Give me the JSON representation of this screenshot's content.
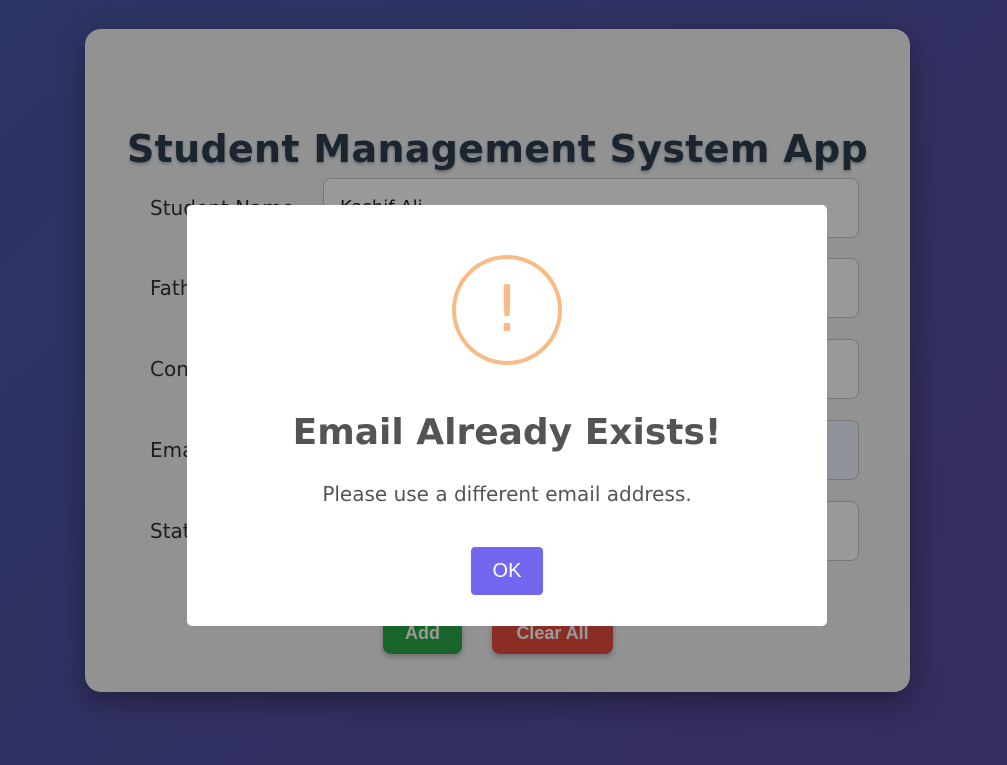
{
  "app": {
    "title": "Student Management System App"
  },
  "form": {
    "student_name": {
      "label": "Student Name",
      "value": "Kashif Ali"
    },
    "father_name": {
      "label": "Father Name",
      "value": ""
    },
    "contact": {
      "label": "Contact",
      "value": ""
    },
    "email": {
      "label": "Email",
      "value": ""
    },
    "status": {
      "label": "Status",
      "value": ""
    }
  },
  "actions": {
    "add_label": "Add",
    "clear_label": "Clear All"
  },
  "alert": {
    "icon_symbol": "!",
    "icon": "warning-icon",
    "title": "Email Already Exists!",
    "message": "Please use a different email address.",
    "ok_label": "OK"
  },
  "colors": {
    "add": "#28a745",
    "clear": "#e74c3c",
    "ok": "#7367f0",
    "warning": "#f8bb86"
  }
}
